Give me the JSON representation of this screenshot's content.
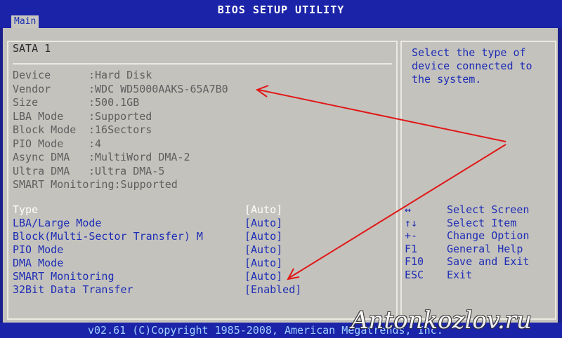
{
  "title": "BIOS SETUP UTILITY",
  "tabs": [
    {
      "label": "Main",
      "selected": true
    }
  ],
  "section_title": "SATA 1",
  "device_info": [
    {
      "label": "Device",
      "value": ":Hard Disk"
    },
    {
      "label": "Vendor",
      "value": ":WDC WD5000AAKS-65A7B0"
    },
    {
      "label": "Size",
      "value": ":500.1GB"
    },
    {
      "label": "LBA Mode",
      "value": ":Supported"
    },
    {
      "label": "Block Mode",
      "value": ":16Sectors"
    },
    {
      "label": "PIO Mode",
      "value": ":4"
    },
    {
      "label": "Async DMA",
      "value": ":MultiWord DMA-2"
    },
    {
      "label": "Ultra DMA",
      "value": ":Ultra DMA-5"
    },
    {
      "label": "SMART Monitoring",
      "value": ":Supported"
    }
  ],
  "options": [
    {
      "label": "Type",
      "value": "[Auto]",
      "selected": true
    },
    {
      "label": "LBA/Large Mode",
      "value": "[Auto]"
    },
    {
      "label": "Block(Multi-Sector Transfer) M",
      "value": "[Auto]"
    },
    {
      "label": "PIO Mode",
      "value": "[Auto]"
    },
    {
      "label": "DMA Mode",
      "value": "[Auto]"
    },
    {
      "label": "SMART Monitoring",
      "value": "[Auto]"
    },
    {
      "label": "32Bit Data Transfer",
      "value": "[Enabled]"
    }
  ],
  "help_text": "Select the type of device connected to the system.",
  "key_legend": [
    {
      "key": "↔",
      "desc": "Select Screen"
    },
    {
      "key": "↑↓",
      "desc": "Select Item"
    },
    {
      "key": "+-",
      "desc": "Change Option"
    },
    {
      "key": "F1",
      "desc": "General Help"
    },
    {
      "key": "F10",
      "desc": "Save and Exit"
    },
    {
      "key": "ESC",
      "desc": "Exit"
    }
  ],
  "footer": "v02.61 (C)Copyright 1985-2008, American Megatrends, Inc.",
  "watermark": "Antonkozlov.ru",
  "colors": {
    "background": "#1a1f8c",
    "panel": "#c4c2bd",
    "option_text": "#1d2db5",
    "info_text": "#5e5e5e",
    "annotation_arrow": "#e01818"
  }
}
